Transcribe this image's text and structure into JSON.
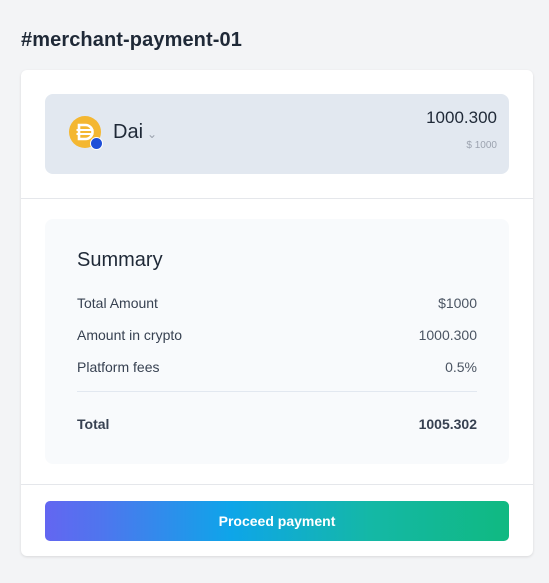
{
  "page": {
    "title": "#merchant-payment-01"
  },
  "token": {
    "name": "Dai",
    "icon": "dai-coin-icon",
    "badge_icon": "network-badge-icon",
    "selector_icon": "chevron-down-icon",
    "crypto_amount": "1000.300",
    "fiat_amount": "$ 1000",
    "icon_color": "#f4b731"
  },
  "summary": {
    "title": "Summary",
    "rows": [
      {
        "label": "Total Amount",
        "value": "$1000"
      },
      {
        "label": "Amount in crypto",
        "value": "1000.300"
      },
      {
        "label": "Platform fees",
        "value": "0.5%"
      }
    ],
    "total": {
      "label": "Total",
      "value": "1005.302"
    }
  },
  "actions": {
    "proceed_label": "Proceed payment",
    "gradient": [
      "#6366f1",
      "#0ea5e9",
      "#10b981"
    ]
  }
}
